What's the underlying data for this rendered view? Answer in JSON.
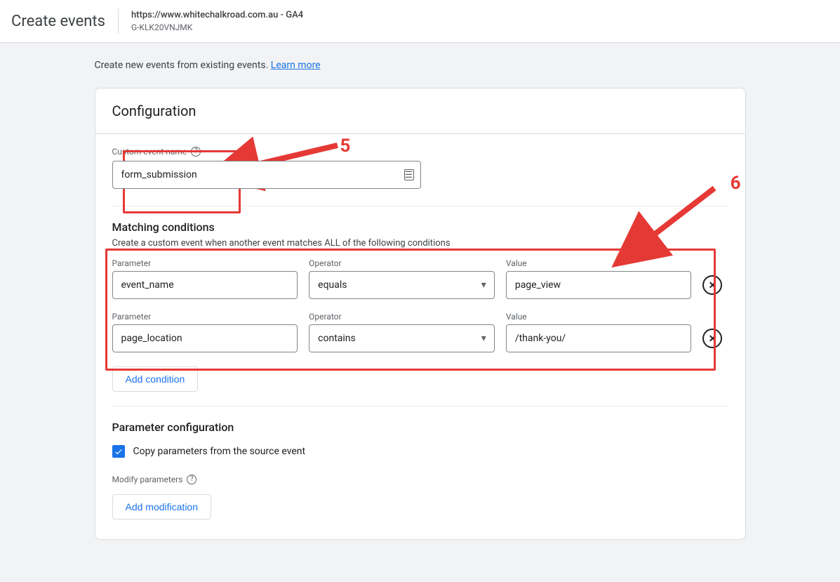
{
  "header": {
    "title": "Create events",
    "property_url": "https://www.whitechalkroad.com.au - GA4",
    "measurement_id": "G-KLK20VNJMK"
  },
  "intro": {
    "text": "Create new events from existing events.",
    "link_label": "Learn more"
  },
  "config": {
    "card_title": "Configuration",
    "custom_event": {
      "label": "Custom event name",
      "value": "form_submission"
    },
    "matching": {
      "title": "Matching conditions",
      "subtitle": "Create a custom event when another event matches ALL of the following conditions",
      "columns": {
        "parameter": "Parameter",
        "operator": "Operator",
        "value": "Value"
      },
      "rows": [
        {
          "parameter": "event_name",
          "operator": "equals",
          "value": "page_view"
        },
        {
          "parameter": "page_location",
          "operator": "contains",
          "value": "/thank-you/"
        }
      ],
      "add_condition_label": "Add condition"
    },
    "param_config": {
      "title": "Parameter configuration",
      "copy_checkbox_label": "Copy parameters from the source event",
      "copy_checked": true,
      "modify_label": "Modify parameters",
      "add_modification_label": "Add modification"
    }
  },
  "annotations": {
    "five": "5",
    "six": "6"
  }
}
